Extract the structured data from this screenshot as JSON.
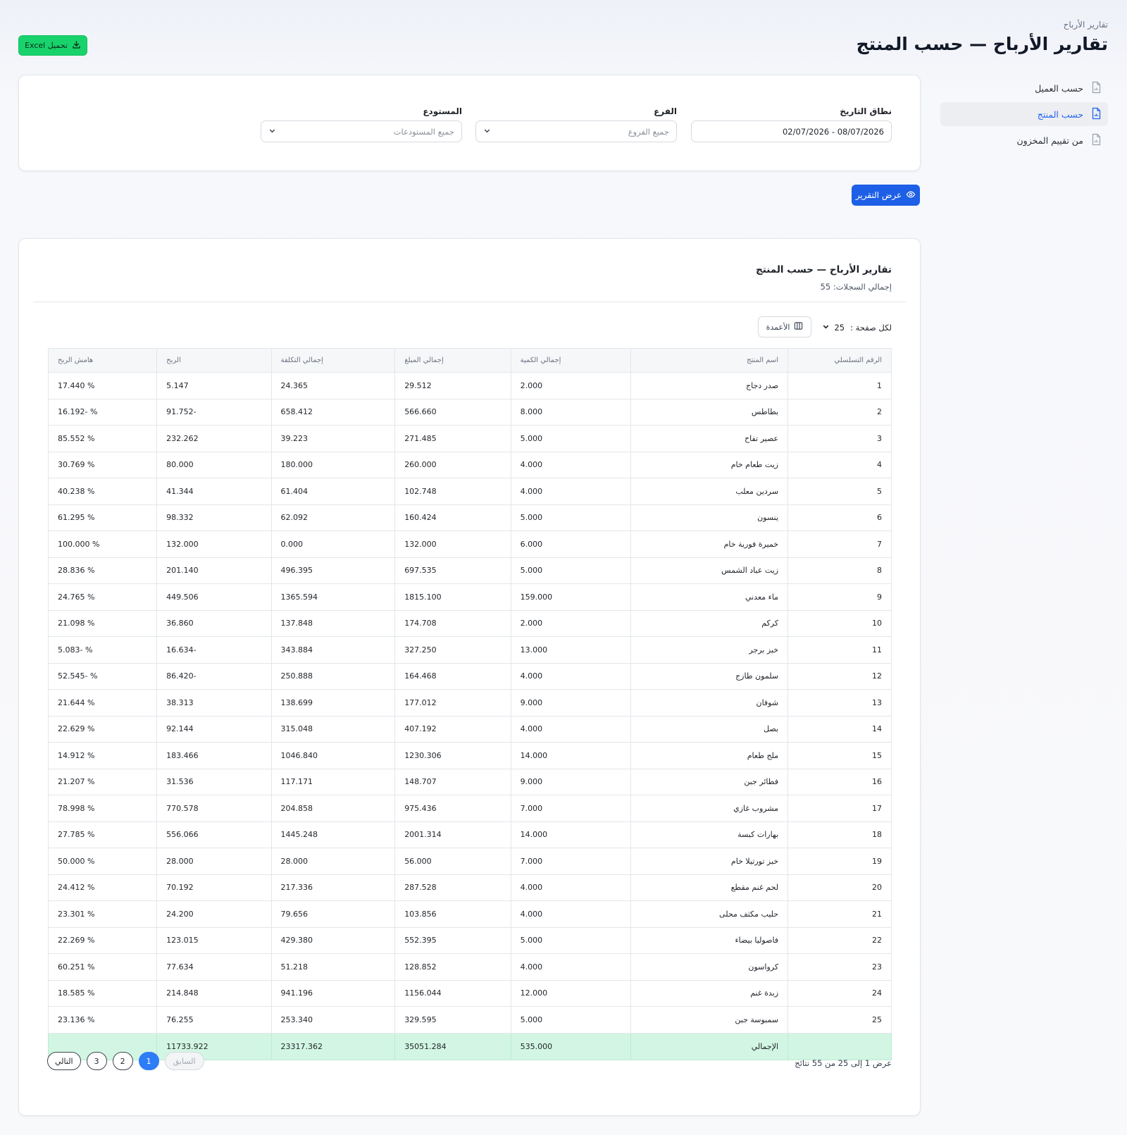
{
  "header": {
    "breadcrumb": "تقارير الأرباح",
    "title": "تقارير الأرباح — حسب المنتج",
    "excel_button": "تحميل Excel"
  },
  "sidebar": {
    "items": [
      {
        "label": "حسب العميل",
        "active": false
      },
      {
        "label": "حسب المنتج",
        "active": true
      },
      {
        "label": "من تقييم المخزون",
        "active": false
      }
    ]
  },
  "filters": {
    "date_label": "نطاق التاريخ",
    "date_value": "08/07/2026 - 02/07/2026",
    "branch_label": "الفرع",
    "branch_placeholder": "جميع الفروع",
    "warehouse_label": "المستودع",
    "warehouse_placeholder": "جميع المستودعات"
  },
  "show_report_button": "عرض التقرير",
  "report": {
    "title": "تقارير الأرباح — حسب المنتج",
    "records": "إجمالي السجلات: 55",
    "per_page_label": "لكل صفحة :",
    "per_page_value": "25",
    "columns_button": "الأعمدة",
    "headers": [
      "الرقم التسلسلي",
      "اسم المنتج",
      "إجمالي الكمية",
      "إجمالي المبلغ",
      "إجمالي التكلفة",
      "الربح",
      "هامش الربح"
    ],
    "rows": [
      [
        "1",
        "صدر دجاج",
        "2.000",
        "29.512",
        "24.365",
        "5.147",
        "% 17.440"
      ],
      [
        "2",
        "بطاطس",
        "8.000",
        "566.660",
        "658.412",
        "-91.752",
        "% -16.192"
      ],
      [
        "3",
        "عصير تفاح",
        "5.000",
        "271.485",
        "39.223",
        "232.262",
        "% 85.552"
      ],
      [
        "4",
        "زيت طعام خام",
        "4.000",
        "260.000",
        "180.000",
        "80.000",
        "% 30.769"
      ],
      [
        "5",
        "سردين معلب",
        "4.000",
        "102.748",
        "61.404",
        "41.344",
        "% 40.238"
      ],
      [
        "6",
        "ينسون",
        "5.000",
        "160.424",
        "62.092",
        "98.332",
        "% 61.295"
      ],
      [
        "7",
        "خميرة فورية خام",
        "6.000",
        "132.000",
        "0.000",
        "132.000",
        "% 100.000"
      ],
      [
        "8",
        "زيت عباد الشمس",
        "5.000",
        "697.535",
        "496.395",
        "201.140",
        "% 28.836"
      ],
      [
        "9",
        "ماء معدني",
        "159.000",
        "1815.100",
        "1365.594",
        "449.506",
        "% 24.765"
      ],
      [
        "10",
        "كركم",
        "2.000",
        "174.708",
        "137.848",
        "36.860",
        "% 21.098"
      ],
      [
        "11",
        "خبز برجر",
        "13.000",
        "327.250",
        "343.884",
        "-16.634",
        "% -5.083"
      ],
      [
        "12",
        "سلمون طازج",
        "4.000",
        "164.468",
        "250.888",
        "-86.420",
        "% -52.545"
      ],
      [
        "13",
        "شوفان",
        "9.000",
        "177.012",
        "138.699",
        "38.313",
        "% 21.644"
      ],
      [
        "14",
        "بصل",
        "4.000",
        "407.192",
        "315.048",
        "92.144",
        "% 22.629"
      ],
      [
        "15",
        "ملح طعام",
        "14.000",
        "1230.306",
        "1046.840",
        "183.466",
        "% 14.912"
      ],
      [
        "16",
        "فطائر جبن",
        "9.000",
        "148.707",
        "117.171",
        "31.536",
        "% 21.207"
      ],
      [
        "17",
        "مشروب غازي",
        "7.000",
        "975.436",
        "204.858",
        "770.578",
        "% 78.998"
      ],
      [
        "18",
        "بهارات كبسة",
        "14.000",
        "2001.314",
        "1445.248",
        "556.066",
        "% 27.785"
      ],
      [
        "19",
        "خبز تورتيلا خام",
        "7.000",
        "56.000",
        "28.000",
        "28.000",
        "% 50.000"
      ],
      [
        "20",
        "لحم غنم مقطع",
        "4.000",
        "287.528",
        "217.336",
        "70.192",
        "% 24.412"
      ],
      [
        "21",
        "حليب مكثف محلى",
        "4.000",
        "103.856",
        "79.656",
        "24.200",
        "% 23.301"
      ],
      [
        "22",
        "فاصوليا بيضاء",
        "5.000",
        "552.395",
        "429.380",
        "123.015",
        "% 22.269"
      ],
      [
        "23",
        "كرواسون",
        "4.000",
        "128.852",
        "51.218",
        "77.634",
        "% 60.251"
      ],
      [
        "24",
        "زبدة غنم",
        "12.000",
        "1156.044",
        "941.196",
        "214.848",
        "% 18.585"
      ],
      [
        "25",
        "سمبوسة جبن",
        "5.000",
        "329.595",
        "253.340",
        "76.255",
        "% 23.136"
      ]
    ],
    "total": [
      "",
      "الإجمالي",
      "535.000",
      "35051.284",
      "23317.362",
      "11733.922",
      ""
    ],
    "showing_text": "عرض 1 إلى 25 من 55 نتائج",
    "pagination": {
      "previous": "السابق",
      "pages": [
        "1",
        "2",
        "3"
      ],
      "current": "1",
      "next": "التالي"
    }
  },
  "colors": {
    "excel_button": "#18d36b",
    "primary": "#1d5fe6",
    "active_link": "#2563eb",
    "total_row": "#d2f6e3"
  }
}
